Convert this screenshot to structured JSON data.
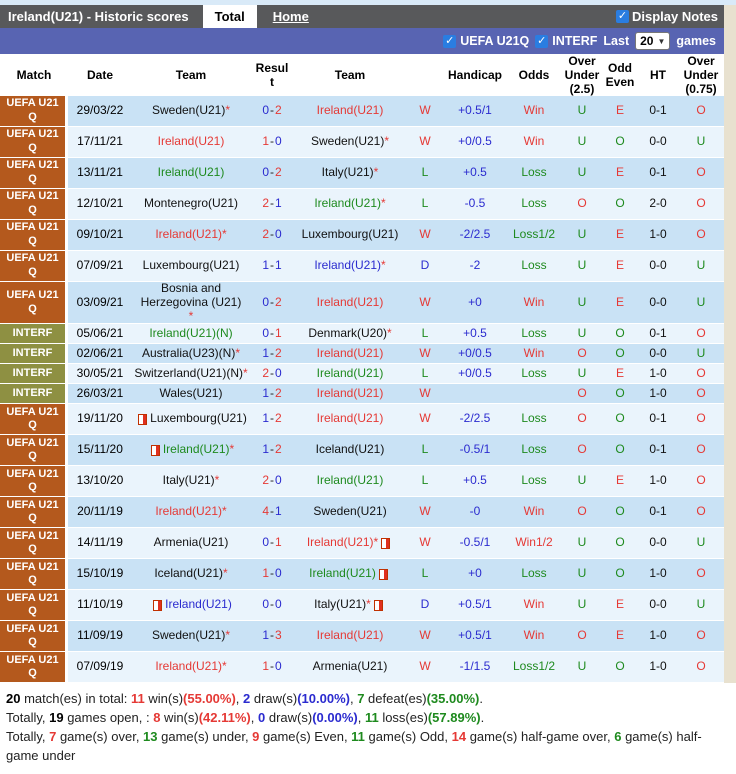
{
  "title_bar": {
    "title": "Ireland(U21) - Historic scores",
    "tab_total": "Total",
    "tab_home": "Home",
    "display_notes": "Display Notes"
  },
  "filter_bar": {
    "uefa_label": "UEFA U21Q",
    "interf_label": "INTERF",
    "last_label": "Last",
    "games_count": "20",
    "games_label": "games"
  },
  "table": {
    "headers": {
      "match": "Match",
      "date": "Date",
      "team1": "Team",
      "result": "Result",
      "team2": "Team",
      "blank": "",
      "handicap": "Handicap",
      "odds": "Odds",
      "ou25": "Over Under (2.5)",
      "oddeven": "Odd Even",
      "ht": "HT",
      "ou075": "Over Under (0.75)"
    },
    "comp_labels": {
      "uefa": "UEFA U21 Q",
      "interf": "INTERF"
    },
    "rows": [
      {
        "comp": "uefa",
        "date": "29/03/22",
        "home": {
          "name": "Sweden(U21)",
          "color": "black",
          "star": true,
          "card": false
        },
        "score": {
          "h": "0",
          "a": "2"
        },
        "away": {
          "name": "Ireland(U21)",
          "color": "red",
          "star": false,
          "card": false
        },
        "res": "W",
        "handicap": "+0.5/1",
        "odds": "Win",
        "ou25": "U",
        "oe": "E",
        "ht": "0-1",
        "ou075": "O"
      },
      {
        "comp": "uefa",
        "date": "17/11/21",
        "home": {
          "name": "Ireland(U21)",
          "color": "red",
          "star": false,
          "card": false
        },
        "score": {
          "h": "1",
          "a": "0"
        },
        "away": {
          "name": "Sweden(U21)",
          "color": "black",
          "star": true,
          "card": false
        },
        "res": "W",
        "handicap": "+0/0.5",
        "odds": "Win",
        "ou25": "U",
        "oe": "O",
        "ht": "0-0",
        "ou075": "U"
      },
      {
        "comp": "uefa",
        "date": "13/11/21",
        "home": {
          "name": "Ireland(U21)",
          "color": "green",
          "star": false,
          "card": false
        },
        "score": {
          "h": "0",
          "a": "2"
        },
        "away": {
          "name": "Italy(U21)",
          "color": "black",
          "star": true,
          "card": false
        },
        "res": "L",
        "handicap": "+0.5",
        "odds": "Loss",
        "ou25": "U",
        "oe": "E",
        "ht": "0-1",
        "ou075": "O"
      },
      {
        "comp": "uefa",
        "date": "12/10/21",
        "home": {
          "name": "Montenegro(U21)",
          "color": "black",
          "star": false,
          "card": false
        },
        "score": {
          "h": "2",
          "a": "1"
        },
        "away": {
          "name": "Ireland(U21)",
          "color": "green",
          "star": true,
          "card": false
        },
        "res": "L",
        "handicap": "-0.5",
        "odds": "Loss",
        "ou25": "O",
        "oe": "O",
        "ht": "2-0",
        "ou075": "O"
      },
      {
        "comp": "uefa",
        "date": "09/10/21",
        "home": {
          "name": "Ireland(U21)",
          "color": "red",
          "star": true,
          "card": false
        },
        "score": {
          "h": "2",
          "a": "0"
        },
        "away": {
          "name": "Luxembourg(U21)",
          "color": "black",
          "star": false,
          "card": false
        },
        "res": "W",
        "handicap": "-2/2.5",
        "odds": "Loss1/2",
        "ou25": "U",
        "oe": "E",
        "ht": "1-0",
        "ou075": "O"
      },
      {
        "comp": "uefa",
        "date": "07/09/21",
        "home": {
          "name": "Luxembourg(U21)",
          "color": "black",
          "star": false,
          "card": false
        },
        "score": {
          "h": "1",
          "a": "1"
        },
        "away": {
          "name": "Ireland(U21)",
          "color": "blue",
          "star": true,
          "card": false
        },
        "res": "D",
        "handicap": "-2",
        "odds": "Loss",
        "ou25": "U",
        "oe": "E",
        "ht": "0-0",
        "ou075": "U"
      },
      {
        "comp": "uefa",
        "date": "03/09/21",
        "home": {
          "name": "Bosnia and Herzegovina (U21)",
          "color": "black",
          "star": true,
          "card": false
        },
        "score": {
          "h": "0",
          "a": "2"
        },
        "away": {
          "name": "Ireland(U21)",
          "color": "red",
          "star": false,
          "card": false
        },
        "res": "W",
        "handicap": "+0",
        "odds": "Win",
        "ou25": "U",
        "oe": "E",
        "ht": "0-0",
        "ou075": "U"
      },
      {
        "comp": "interf",
        "date": "05/06/21",
        "home": {
          "name": "Ireland(U21)(N)",
          "color": "green",
          "star": false,
          "card": false
        },
        "score": {
          "h": "0",
          "a": "1"
        },
        "away": {
          "name": "Denmark(U20)",
          "color": "black",
          "star": true,
          "card": false
        },
        "res": "L",
        "handicap": "+0.5",
        "odds": "Loss",
        "ou25": "U",
        "oe": "O",
        "ht": "0-1",
        "ou075": "O"
      },
      {
        "comp": "interf",
        "date": "02/06/21",
        "home": {
          "name": "Australia(U23)(N)",
          "color": "black",
          "star": true,
          "card": false
        },
        "score": {
          "h": "1",
          "a": "2"
        },
        "away": {
          "name": "Ireland(U21)",
          "color": "red",
          "star": false,
          "card": false
        },
        "res": "W",
        "handicap": "+0/0.5",
        "odds": "Win",
        "ou25": "O",
        "oe": "O",
        "ht": "0-0",
        "ou075": "U"
      },
      {
        "comp": "interf",
        "date": "30/05/21",
        "home": {
          "name": "Switzerland(U21)(N)",
          "color": "black",
          "star": true,
          "card": false
        },
        "score": {
          "h": "2",
          "a": "0"
        },
        "away": {
          "name": "Ireland(U21)",
          "color": "green",
          "star": false,
          "card": false
        },
        "res": "L",
        "handicap": "+0/0.5",
        "odds": "Loss",
        "ou25": "U",
        "oe": "E",
        "ht": "1-0",
        "ou075": "O"
      },
      {
        "comp": "interf",
        "date": "26/03/21",
        "home": {
          "name": "Wales(U21)",
          "color": "black",
          "star": false,
          "card": false
        },
        "score": {
          "h": "1",
          "a": "2"
        },
        "away": {
          "name": "Ireland(U21)",
          "color": "red",
          "star": false,
          "card": false
        },
        "res": "W",
        "handicap": "",
        "odds": "",
        "ou25": "O",
        "oe": "O",
        "ht": "1-0",
        "ou075": "O"
      },
      {
        "comp": "uefa",
        "date": "19/11/20",
        "home": {
          "name": "Luxembourg(U21)",
          "color": "black",
          "star": false,
          "card": true
        },
        "score": {
          "h": "1",
          "a": "2"
        },
        "away": {
          "name": "Ireland(U21)",
          "color": "red",
          "star": false,
          "card": false
        },
        "res": "W",
        "handicap": "-2/2.5",
        "odds": "Loss",
        "ou25": "O",
        "oe": "O",
        "ht": "0-1",
        "ou075": "O"
      },
      {
        "comp": "uefa",
        "date": "15/11/20",
        "home": {
          "name": "Ireland(U21)",
          "color": "green",
          "star": true,
          "card": true
        },
        "score": {
          "h": "1",
          "a": "2"
        },
        "away": {
          "name": "Iceland(U21)",
          "color": "black",
          "star": false,
          "card": false
        },
        "res": "L",
        "handicap": "-0.5/1",
        "odds": "Loss",
        "ou25": "O",
        "oe": "O",
        "ht": "0-1",
        "ou075": "O"
      },
      {
        "comp": "uefa",
        "date": "13/10/20",
        "home": {
          "name": "Italy(U21)",
          "color": "black",
          "star": true,
          "card": false
        },
        "score": {
          "h": "2",
          "a": "0"
        },
        "away": {
          "name": "Ireland(U21)",
          "color": "green",
          "star": false,
          "card": false
        },
        "res": "L",
        "handicap": "+0.5",
        "odds": "Loss",
        "ou25": "U",
        "oe": "E",
        "ht": "1-0",
        "ou075": "O"
      },
      {
        "comp": "uefa",
        "date": "20/11/19",
        "home": {
          "name": "Ireland(U21)",
          "color": "red",
          "star": true,
          "card": false
        },
        "score": {
          "h": "4",
          "a": "1"
        },
        "away": {
          "name": "Sweden(U21)",
          "color": "black",
          "star": false,
          "card": false
        },
        "res": "W",
        "handicap": "-0",
        "odds": "Win",
        "ou25": "O",
        "oe": "O",
        "ht": "0-1",
        "ou075": "O"
      },
      {
        "comp": "uefa",
        "date": "14/11/19",
        "home": {
          "name": "Armenia(U21)",
          "color": "black",
          "star": false,
          "card": false
        },
        "score": {
          "h": "0",
          "a": "1"
        },
        "away": {
          "name": "Ireland(U21)",
          "color": "red",
          "star": true,
          "card": true
        },
        "res": "W",
        "handicap": "-0.5/1",
        "odds": "Win1/2",
        "ou25": "U",
        "oe": "O",
        "ht": "0-0",
        "ou075": "U"
      },
      {
        "comp": "uefa",
        "date": "15/10/19",
        "home": {
          "name": "Iceland(U21)",
          "color": "black",
          "star": true,
          "card": false
        },
        "score": {
          "h": "1",
          "a": "0"
        },
        "away": {
          "name": "Ireland(U21)",
          "color": "green",
          "star": false,
          "card": true
        },
        "res": "L",
        "handicap": "+0",
        "odds": "Loss",
        "ou25": "U",
        "oe": "O",
        "ht": "1-0",
        "ou075": "O"
      },
      {
        "comp": "uefa",
        "date": "11/10/19",
        "home": {
          "name": "Ireland(U21)",
          "color": "blue",
          "star": false,
          "card": true
        },
        "score": {
          "h": "0",
          "a": "0"
        },
        "away": {
          "name": "Italy(U21)",
          "color": "black",
          "star": true,
          "card": true
        },
        "res": "D",
        "handicap": "+0.5/1",
        "odds": "Win",
        "ou25": "U",
        "oe": "E",
        "ht": "0-0",
        "ou075": "U"
      },
      {
        "comp": "uefa",
        "date": "11/09/19",
        "home": {
          "name": "Sweden(U21)",
          "color": "black",
          "star": true,
          "card": false
        },
        "score": {
          "h": "1",
          "a": "3"
        },
        "away": {
          "name": "Ireland(U21)",
          "color": "red",
          "star": false,
          "card": false
        },
        "res": "W",
        "handicap": "+0.5/1",
        "odds": "Win",
        "ou25": "O",
        "oe": "E",
        "ht": "1-0",
        "ou075": "O"
      },
      {
        "comp": "uefa",
        "date": "07/09/19",
        "home": {
          "name": "Ireland(U21)",
          "color": "red",
          "star": true,
          "card": false
        },
        "score": {
          "h": "1",
          "a": "0"
        },
        "away": {
          "name": "Armenia(U21)",
          "color": "black",
          "star": false,
          "card": false
        },
        "res": "W",
        "handicap": "-1/1.5",
        "odds": "Loss1/2",
        "ou25": "U",
        "oe": "O",
        "ht": "1-0",
        "ou075": "O"
      }
    ]
  },
  "footer": {
    "lines": [
      [
        {
          "t": "20",
          "s": "b"
        },
        {
          "t": " match(es) in total: ",
          "s": "p"
        },
        {
          "t": "11",
          "s": "r"
        },
        {
          "t": " win(s)",
          "s": "p"
        },
        {
          "t": "(55.00%)",
          "s": "r"
        },
        {
          "t": ", ",
          "s": "p"
        },
        {
          "t": "2",
          "s": "u"
        },
        {
          "t": " draw(s)",
          "s": "p"
        },
        {
          "t": "(10.00%)",
          "s": "u"
        },
        {
          "t": ", ",
          "s": "p"
        },
        {
          "t": "7",
          "s": "g"
        },
        {
          "t": " defeat(es)",
          "s": "p"
        },
        {
          "t": "(35.00%)",
          "s": "g"
        },
        {
          "t": ".",
          "s": "p"
        }
      ],
      [
        {
          "t": "Totally, ",
          "s": "p"
        },
        {
          "t": "19",
          "s": "b"
        },
        {
          "t": " games open, : ",
          "s": "p"
        },
        {
          "t": "8",
          "s": "r"
        },
        {
          "t": " win(s)",
          "s": "p"
        },
        {
          "t": "(42.11%)",
          "s": "r"
        },
        {
          "t": ", ",
          "s": "p"
        },
        {
          "t": "0",
          "s": "u"
        },
        {
          "t": " draw(s)",
          "s": "p"
        },
        {
          "t": "(0.00%)",
          "s": "u"
        },
        {
          "t": ", ",
          "s": "p"
        },
        {
          "t": "11",
          "s": "g"
        },
        {
          "t": " loss(es)",
          "s": "p"
        },
        {
          "t": "(57.89%)",
          "s": "g"
        },
        {
          "t": ".",
          "s": "p"
        }
      ],
      [
        {
          "t": "Totally, ",
          "s": "p"
        },
        {
          "t": "7",
          "s": "r"
        },
        {
          "t": " game(s) over, ",
          "s": "p"
        },
        {
          "t": "13",
          "s": "g"
        },
        {
          "t": " game(s) under, ",
          "s": "p"
        },
        {
          "t": "9",
          "s": "r"
        },
        {
          "t": " game(s) Even, ",
          "s": "p"
        },
        {
          "t": "11",
          "s": "g"
        },
        {
          "t": " game(s) Odd, ",
          "s": "p"
        },
        {
          "t": "14",
          "s": "r"
        },
        {
          "t": " game(s) half-game over, ",
          "s": "p"
        },
        {
          "t": "6",
          "s": "g"
        },
        {
          "t": " game(s) half-game under",
          "s": "p"
        }
      ]
    ]
  },
  "colors": {
    "win_red": "#e53935",
    "loss_green": "#1e8a1e",
    "draw_blue": "#2b2bcf",
    "uefa_label_bg": "#b4591d",
    "interf_label_bg": "#8e9042",
    "row_dark": "#c9e2f5",
    "row_light": "#eaf4fc",
    "top_bar_bg": "#58595b",
    "filter_bar_bg": "#5864b2",
    "page_bg": "#e8e1cf"
  }
}
